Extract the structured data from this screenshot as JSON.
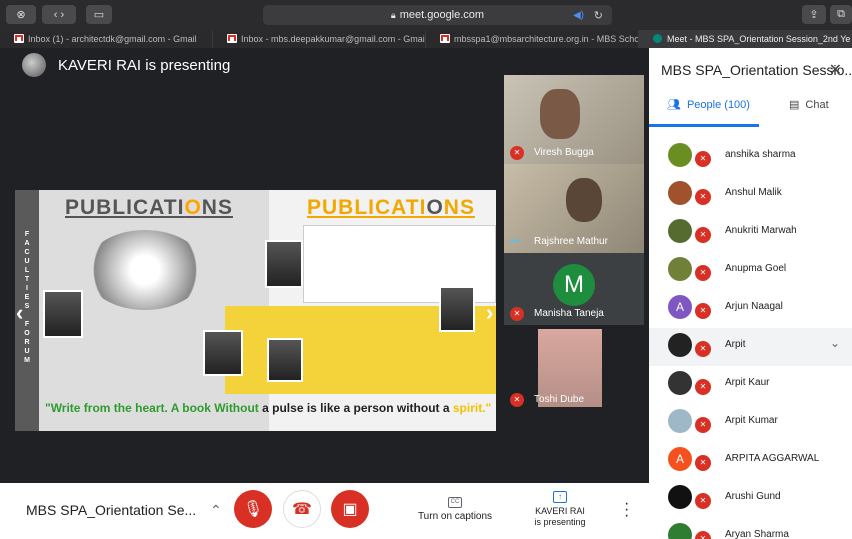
{
  "browser": {
    "url": "meet.google.com",
    "tabs": [
      {
        "label": "Inbox (1) - architectdk@gmail.com - Gmail",
        "icon": "gmail-icon"
      },
      {
        "label": "Inbox - mbs.deepakkumar@gmail.com - Gmail",
        "icon": "gmail-icon"
      },
      {
        "label": "mbsspa1@mbsarchitecture.org.in - MBS School...",
        "icon": "gmail-icon"
      },
      {
        "label": "Meet - MBS SPA_Orientation Session_2nd Ye...",
        "icon": "meet-icon",
        "active": true
      }
    ]
  },
  "presenter": {
    "text": "KAVERI RAI is presenting"
  },
  "slide": {
    "side_text": "FACULTIES FORUM",
    "pub_left": [
      "PUBLICATI",
      "O",
      "NS"
    ],
    "pub_right": [
      "PUBLICATI",
      "O",
      "NS"
    ],
    "quote": {
      "part1": "\"Write from the heart. A book Without ",
      "part2": "a pulse is like a person without a ",
      "part3": "spirit.\""
    }
  },
  "participants_tiles": [
    {
      "name": "Viresh Bugga",
      "mic": "muted"
    },
    {
      "name": "Rajshree Mathur",
      "mic": "speaking"
    },
    {
      "name": "Manisha Taneja",
      "mic": "muted",
      "initial": "M"
    },
    {
      "name": "Toshi Dube",
      "mic": "muted"
    }
  ],
  "panel": {
    "title": "MBS SPA_Orientation Sessio...",
    "tabs": {
      "people": "People (100)",
      "chat": "Chat"
    },
    "people": [
      {
        "name": "anshika sharma",
        "color": "#6b8e23"
      },
      {
        "name": "Anshul Malik",
        "color": "#a0522d"
      },
      {
        "name": "Anukriti Marwah",
        "color": "#556b2f"
      },
      {
        "name": "Anupma Goel",
        "color": "#708038"
      },
      {
        "name": "Arjun Naagal",
        "color": "#7e57c2",
        "initial": "A"
      },
      {
        "name": "Arpit",
        "color": "#222222",
        "highlight": true
      },
      {
        "name": "Arpit Kaur",
        "color": "#333333"
      },
      {
        "name": "Arpit Kumar",
        "color": "#9fb8c8"
      },
      {
        "name": "ARPITA AGGARWAL",
        "color": "#f4511e",
        "initial": "A"
      },
      {
        "name": "Arushi Gund",
        "color": "#111111"
      },
      {
        "name": "Aryan Sharma",
        "color": "#2e7d32"
      }
    ]
  },
  "bottombar": {
    "meeting_name": "MBS SPA_Orientation Se...",
    "captions": "Turn on captions",
    "cc_icon_text": "CC",
    "presenting_name": "KAVERI RAI",
    "presenting_label": "is presenting"
  }
}
